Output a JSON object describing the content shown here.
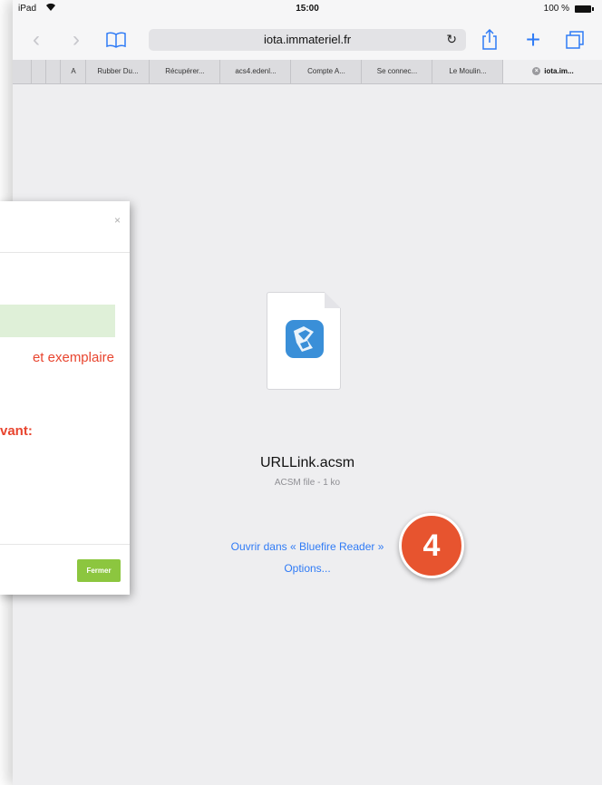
{
  "statusbar": {
    "carrier": "iPad",
    "time": "15:00",
    "battery": "100 %"
  },
  "toolbar": {
    "url": "iota.immateriel.fr",
    "back_icon": "chevron-left-icon",
    "forward_icon": "chevron-right-icon",
    "bookmarks_icon": "book-icon",
    "reload_icon": "reload-icon",
    "share_icon": "share-icon",
    "add_icon": "plus-icon",
    "tabs_icon": "tabs-icon",
    "accent": "#2f7bf6"
  },
  "tabs": [
    {
      "label": "A"
    },
    {
      "label": "Rubber Du..."
    },
    {
      "label": "Récupérer..."
    },
    {
      "label": "acs4.edenl..."
    },
    {
      "label": "Compte A..."
    },
    {
      "label": "Se connec..."
    },
    {
      "label": "Le Moulin..."
    },
    {
      "label": "iota.im..."
    }
  ],
  "file": {
    "name": "URLLink.acsm",
    "meta": "ACSM file - 1 ko",
    "open_in": "Ouvrir dans « Bluefire Reader »",
    "options": "Options..."
  },
  "dialog": {
    "close": "×",
    "line1": "et exemplaire",
    "line2": "vant:",
    "button": "Fermer",
    "button_color": "#8cc63f",
    "text_color": "#e8452f"
  },
  "badge": {
    "number": "4",
    "color": "#e7542f"
  }
}
